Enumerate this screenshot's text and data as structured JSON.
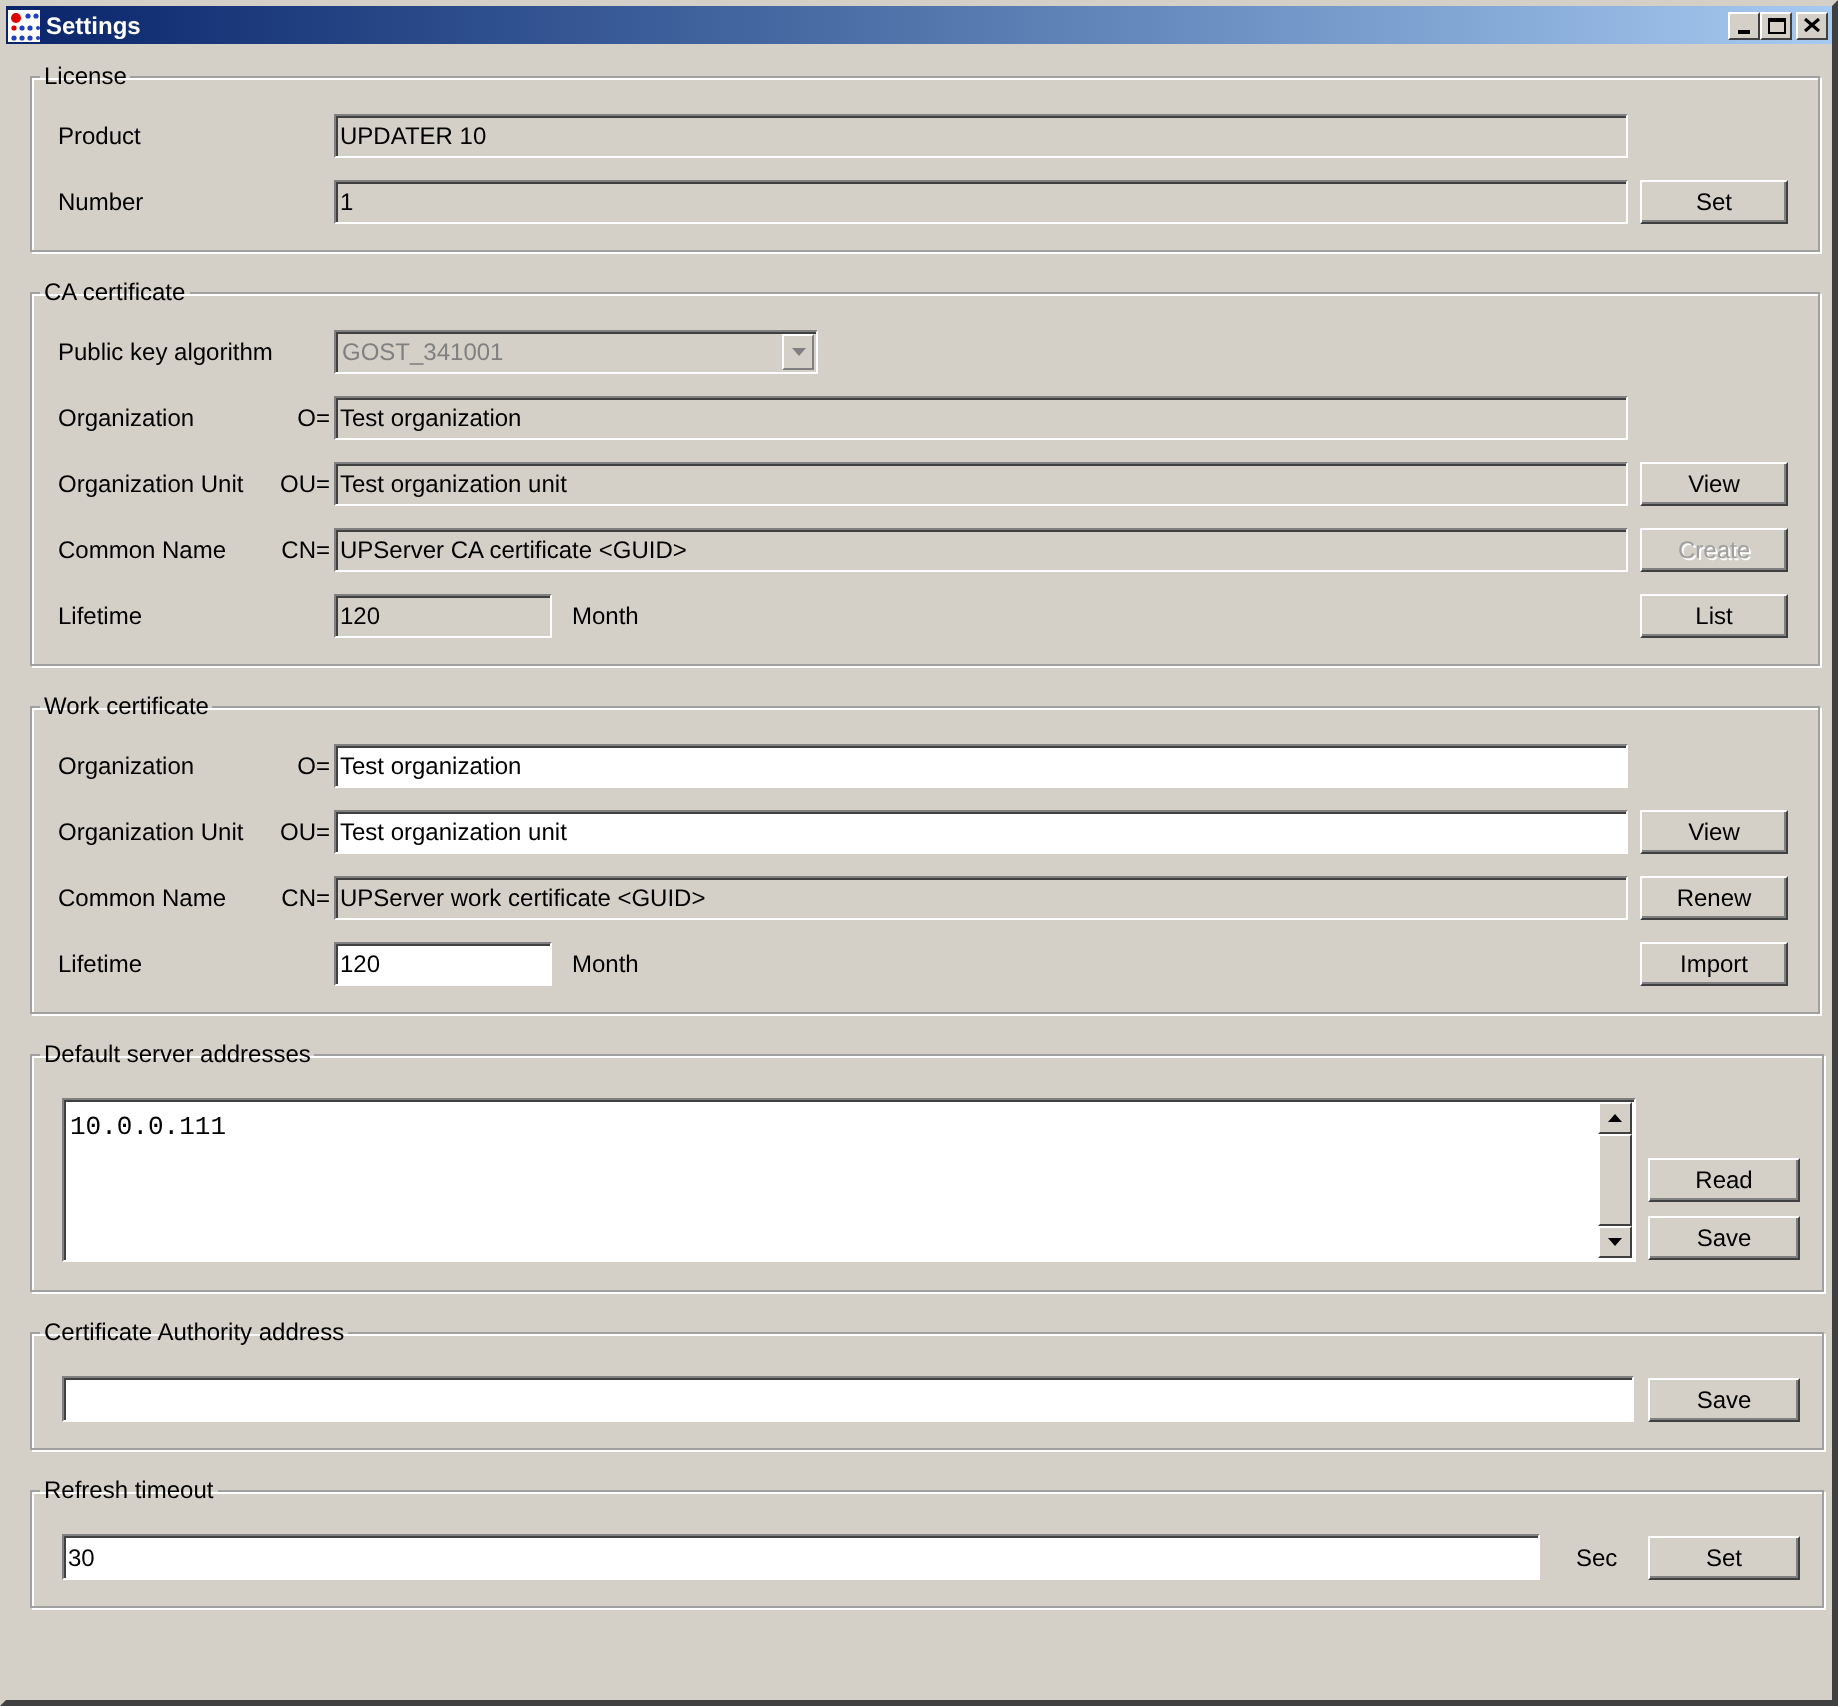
{
  "window": {
    "title": "Settings"
  },
  "groups": [
    {
      "kind": "form",
      "title": "License",
      "rows": [
        {
          "kind": "field",
          "label": "Product",
          "value": "UPDATER 10",
          "editable": false
        },
        {
          "kind": "field",
          "label": "Number",
          "value": "1",
          "editable": false,
          "button": {
            "label": "Set",
            "disabled": false
          }
        }
      ]
    },
    {
      "kind": "form",
      "title": "CA certificate",
      "rows": [
        {
          "kind": "dropdown",
          "label": "Public key algorithm",
          "value": "GOST_341001",
          "disabled": true
        },
        {
          "kind": "field",
          "label": "Organization",
          "prefix": "O=",
          "value": "Test organization",
          "editable": false
        },
        {
          "kind": "field",
          "label": "Organization Unit",
          "prefix": "OU=",
          "value": "Test organization unit",
          "editable": false,
          "button": {
            "label": "View",
            "disabled": false
          }
        },
        {
          "kind": "field",
          "label": "Common Name",
          "prefix": "CN=",
          "value": "UPServer CA certificate <GUID>",
          "editable": false,
          "button": {
            "label": "Create",
            "disabled": true
          }
        },
        {
          "kind": "short",
          "label": "Lifetime",
          "value": "120",
          "unit": "Month",
          "editable": false,
          "button": {
            "label": "List",
            "disabled": false
          }
        }
      ]
    },
    {
      "kind": "form",
      "title": "Work certificate",
      "rows": [
        {
          "kind": "field",
          "label": "Organization",
          "prefix": "O=",
          "value": "Test organization",
          "editable": true
        },
        {
          "kind": "field",
          "label": "Organization Unit",
          "prefix": "OU=",
          "value": "Test organization unit",
          "editable": true,
          "button": {
            "label": "View",
            "disabled": false
          }
        },
        {
          "kind": "field",
          "label": "Common Name",
          "prefix": "CN=",
          "value": "UPServer work certificate <GUID>",
          "editable": false,
          "button": {
            "label": "Renew",
            "disabled": false
          }
        },
        {
          "kind": "short",
          "label": "Lifetime",
          "value": "120",
          "unit": "Month",
          "editable": true,
          "button": {
            "label": "Import",
            "disabled": false
          }
        }
      ]
    },
    {
      "kind": "list",
      "title": "Default server addresses",
      "value": "10.0.0.111",
      "buttons": [
        {
          "label": "Read",
          "disabled": false
        },
        {
          "label": "Save",
          "disabled": false
        }
      ]
    },
    {
      "kind": "line",
      "title": "Certificate Authority address",
      "buttons": [
        {
          "label": "Save",
          "disabled": false
        }
      ]
    },
    {
      "kind": "line",
      "title": "Refresh timeout",
      "value": "30",
      "unit": "Sec",
      "buttons": [
        {
          "label": "Set",
          "disabled": false
        }
      ]
    }
  ]
}
